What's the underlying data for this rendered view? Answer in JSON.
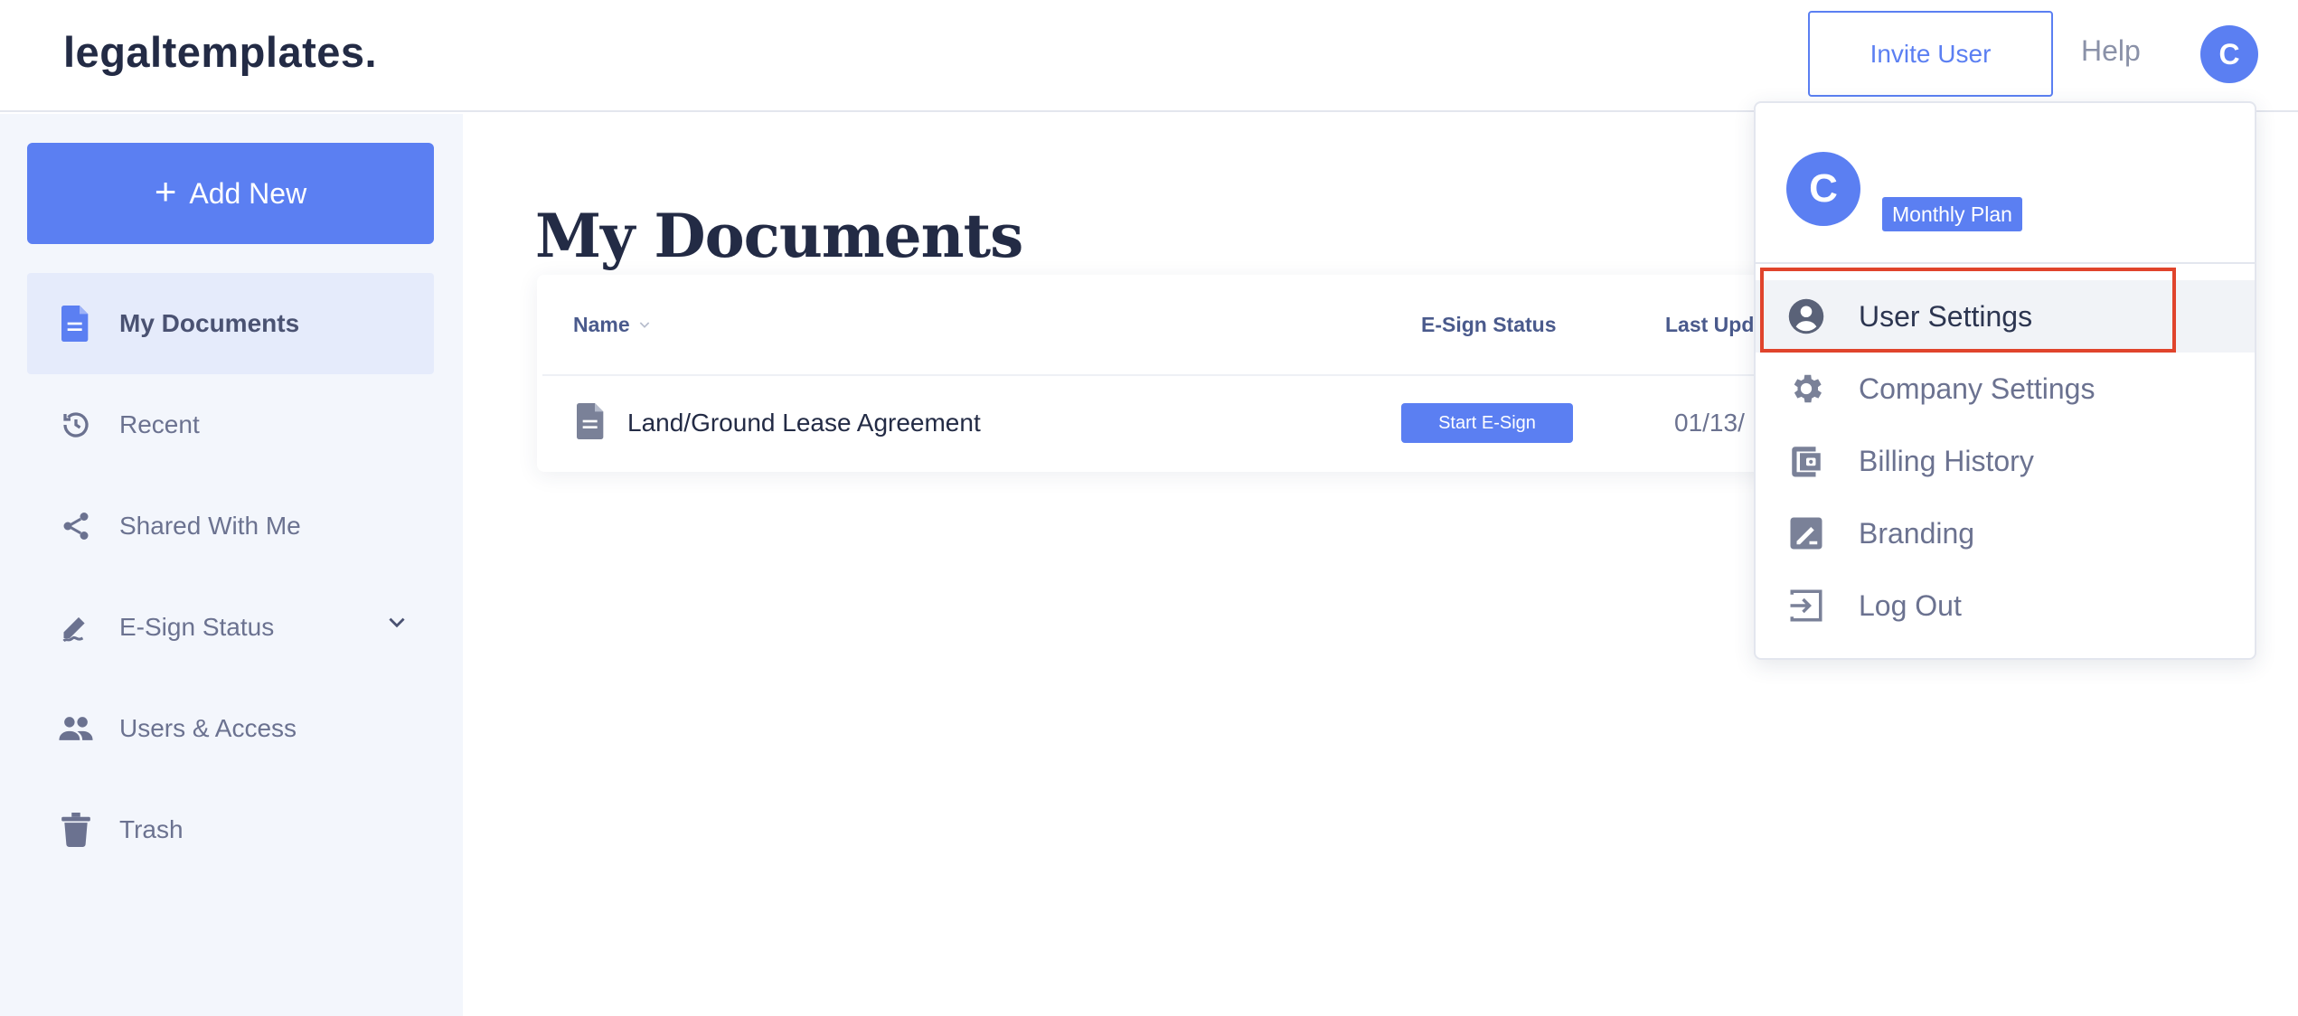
{
  "header": {
    "logo": "legaltemplates.",
    "invite_label": "Invite User",
    "help_label": "Help",
    "avatar_initial": "C"
  },
  "sidebar": {
    "add_new_label": "Add New",
    "items": [
      {
        "label": "My Documents",
        "icon": "document-icon",
        "active": true
      },
      {
        "label": "Recent",
        "icon": "history-icon"
      },
      {
        "label": "Shared With Me",
        "icon": "share-icon"
      },
      {
        "label": "E-Sign Status",
        "icon": "signature-icon",
        "expandable": true
      },
      {
        "label": "Users & Access",
        "icon": "users-icon"
      },
      {
        "label": "Trash",
        "icon": "trash-icon"
      }
    ]
  },
  "main": {
    "title": "My Documents",
    "table": {
      "columns": [
        "Name",
        "E-Sign Status",
        "Last Upd"
      ],
      "rows": [
        {
          "name": "Land/Ground Lease Agreement",
          "esign_action": "Start E-Sign",
          "last_updated": "01/13/"
        }
      ]
    }
  },
  "dropdown": {
    "avatar_initial": "C",
    "plan": "Monthly Plan",
    "items": [
      {
        "label": "User Settings",
        "icon": "account-circle-icon",
        "highlighted": true
      },
      {
        "label": "Company Settings",
        "icon": "gear-icon"
      },
      {
        "label": "Billing History",
        "icon": "wallet-icon"
      },
      {
        "label": "Branding",
        "icon": "branding-icon"
      },
      {
        "label": "Log Out",
        "icon": "logout-icon"
      }
    ]
  },
  "colors": {
    "accent": "#5b7ff2",
    "sidebar_bg": "#f3f6fc",
    "active_item_bg": "#e5ebfb",
    "highlight_border": "#e0442c",
    "title_text": "#232b45"
  }
}
